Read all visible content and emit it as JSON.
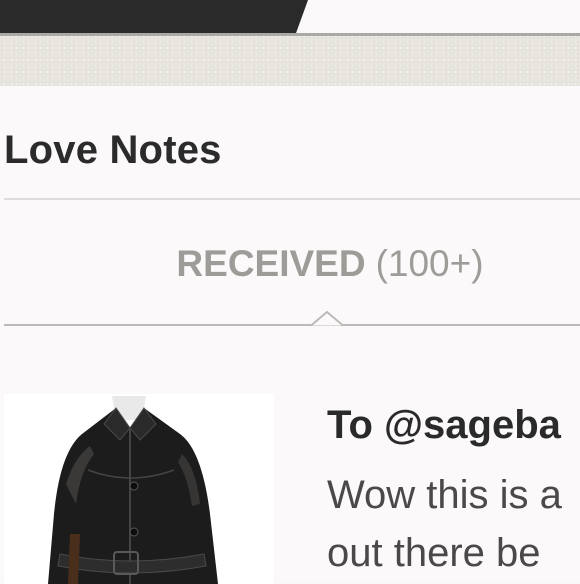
{
  "header": {
    "title": "Love Notes"
  },
  "tabs": {
    "received_label": "RECEIVED",
    "received_count": "(100+)"
  },
  "note": {
    "to": "To @sageba",
    "body_line1": "Wow this is a",
    "body_line2": "out there be",
    "image_icon": "leather-jacket-photo"
  },
  "colors": {
    "top_tab": "#2b2a2b",
    "texture": "#e9e6e0",
    "text_primary": "#2c2b2c",
    "tab_text": "#9f9b98",
    "divider": "#dedcdc"
  }
}
